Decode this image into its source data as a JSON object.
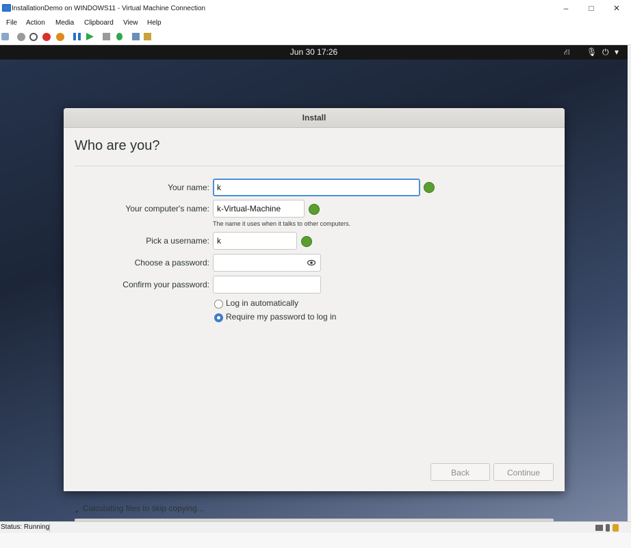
{
  "window": {
    "title": "InstallationDemo on WINDOWS11 - Virtual Machine Connection",
    "minimize": "–",
    "maximize": "□",
    "close": "✕"
  },
  "menu": [
    "File",
    "Action",
    "Media",
    "Clipboard",
    "View",
    "Help"
  ],
  "toolbar_icons": [
    "ctrl-alt-del-icon",
    "start-icon",
    "turn-off-icon",
    "shutdown-icon",
    "power-icon",
    "pause-icon",
    "resume-icon",
    "checkpoint-icon",
    "revert-icon",
    "enhanced-session-icon",
    "share-icon"
  ],
  "guest_topbar": {
    "clock": "Jun 30 17:26",
    "network_icon": "⛙",
    "mic_icon": "🎙",
    "power_icon": "⏻",
    "menu_arrow": "▾"
  },
  "dialog": {
    "title": "Install",
    "heading": "Who are you?",
    "fields": {
      "name_label": "Your name:",
      "name_value": "k",
      "computer_label": "Your computer's name:",
      "computer_value": "k-Virtual-Machine",
      "computer_hint": "The name it uses when it talks to other computers.",
      "username_label": "Pick a username:",
      "username_value": "k",
      "password_label": "Choose a password:",
      "password_value": "",
      "confirm_label": "Confirm your password:",
      "confirm_value": ""
    },
    "login_options": {
      "auto": "Log in automatically",
      "require": "Require my password to log in",
      "selected": "require"
    },
    "buttons": {
      "back": "Back",
      "continue": "Continue"
    },
    "status_text": "Calculating files to skip copying...",
    "expander": "▸"
  },
  "statusbar": {
    "status": "Status: Running"
  }
}
